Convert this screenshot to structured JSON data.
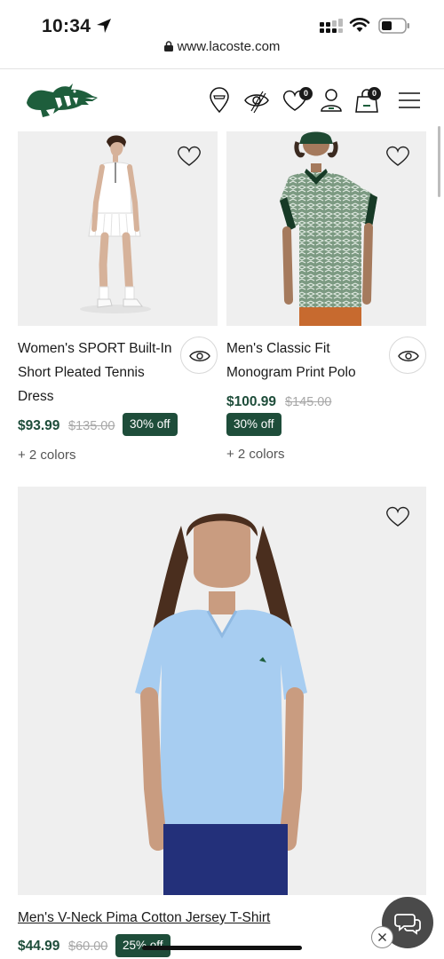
{
  "status_bar": {
    "time": "10:34",
    "icons": [
      "location-arrow-icon",
      "signal-icon",
      "wifi-icon",
      "battery-icon"
    ]
  },
  "browser": {
    "url": "www.lacoste.com"
  },
  "header": {
    "brand": "Lacoste",
    "wishlist_count": "0",
    "cart_count": "0",
    "icons": [
      "store-locator-icon",
      "recently-viewed-icon",
      "wishlist-heart-icon",
      "account-icon",
      "cart-bag-icon",
      "menu-icon"
    ]
  },
  "products": [
    {
      "name_lines": [
        "Women's SPORT Built-In",
        "Short Pleated Tennis",
        "Dress"
      ],
      "price": "$93.99",
      "old_price": "$135.00",
      "discount": "30% off",
      "colors": "+ 2 colors"
    },
    {
      "name_lines": [
        "Men's Classic Fit",
        "Monogram Print Polo"
      ],
      "price": "$100.99",
      "old_price": "$145.00",
      "discount": "30% off",
      "colors": "+ 2 colors"
    },
    {
      "name": "Men's V-Neck Pima Cotton Jersey T-Shirt",
      "price": "$44.99",
      "old_price": "$60.00",
      "discount": "25% off"
    }
  ],
  "colors": {
    "brand_green": "#1e4d3a",
    "strike_gray": "#a8a8a8",
    "image_bg": "#efefef"
  }
}
